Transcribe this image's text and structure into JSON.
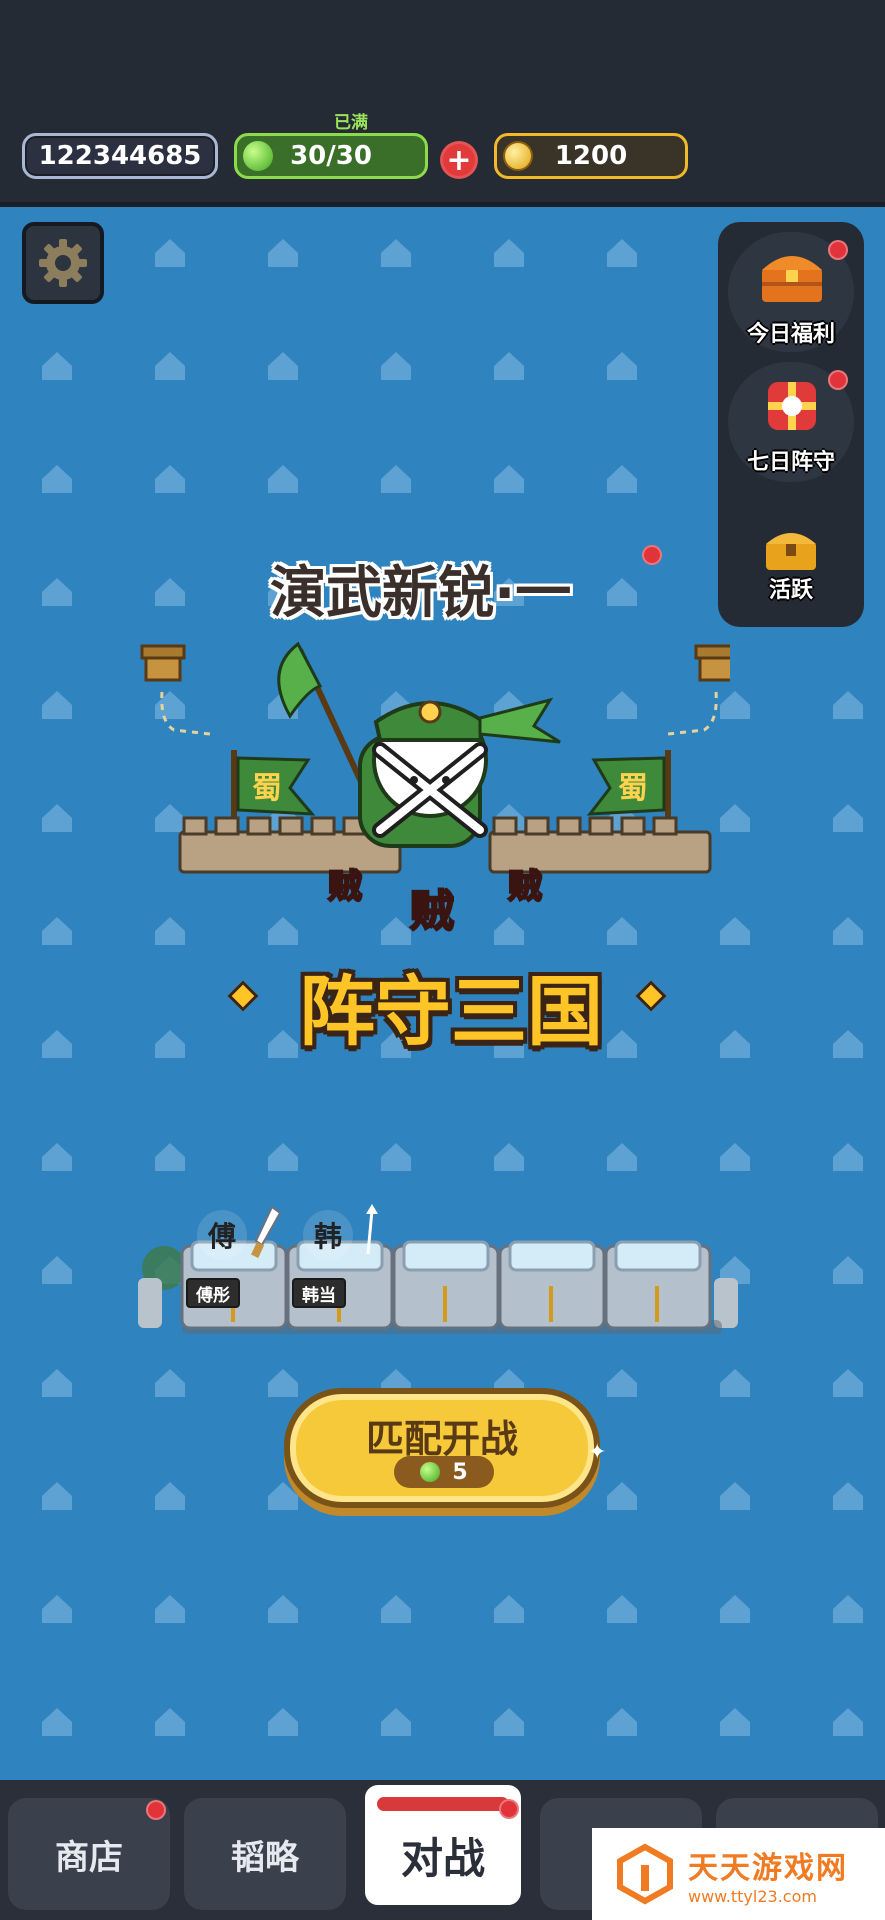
{
  "topbar": {
    "player_id": "122344685",
    "stamina_status": "已满",
    "stamina": "30/30",
    "gold": "1200",
    "plus_symbol": "+"
  },
  "side_menu": {
    "items": [
      {
        "label": "今日福利",
        "icon": "treasure-chest-icon"
      },
      {
        "label": "七日阵守",
        "icon": "gift-box-icon"
      },
      {
        "label": "活跃",
        "icon": "small-chest-icon"
      }
    ]
  },
  "stage": {
    "title": "演武新锐·一",
    "banner_text": "蜀",
    "enemy_text": "贼"
  },
  "game_title": "阵守三国",
  "lineup": {
    "heroes": [
      {
        "char": "傅",
        "name": "傅彤"
      },
      {
        "char": "韩",
        "name": "韩当"
      }
    ]
  },
  "start": {
    "label": "匹配开战",
    "cost": "5"
  },
  "bottom_nav": {
    "tabs": [
      "商店",
      "韬略",
      "对战"
    ]
  },
  "watermark": {
    "cn": "天天游戏网",
    "url": "www.ttyl23.com"
  },
  "colors": {
    "background": "#2f83be",
    "topbar": "#242b35",
    "gold": "#ffc527",
    "stamina": "#8ddb4a",
    "reddot": "#e0343a"
  }
}
